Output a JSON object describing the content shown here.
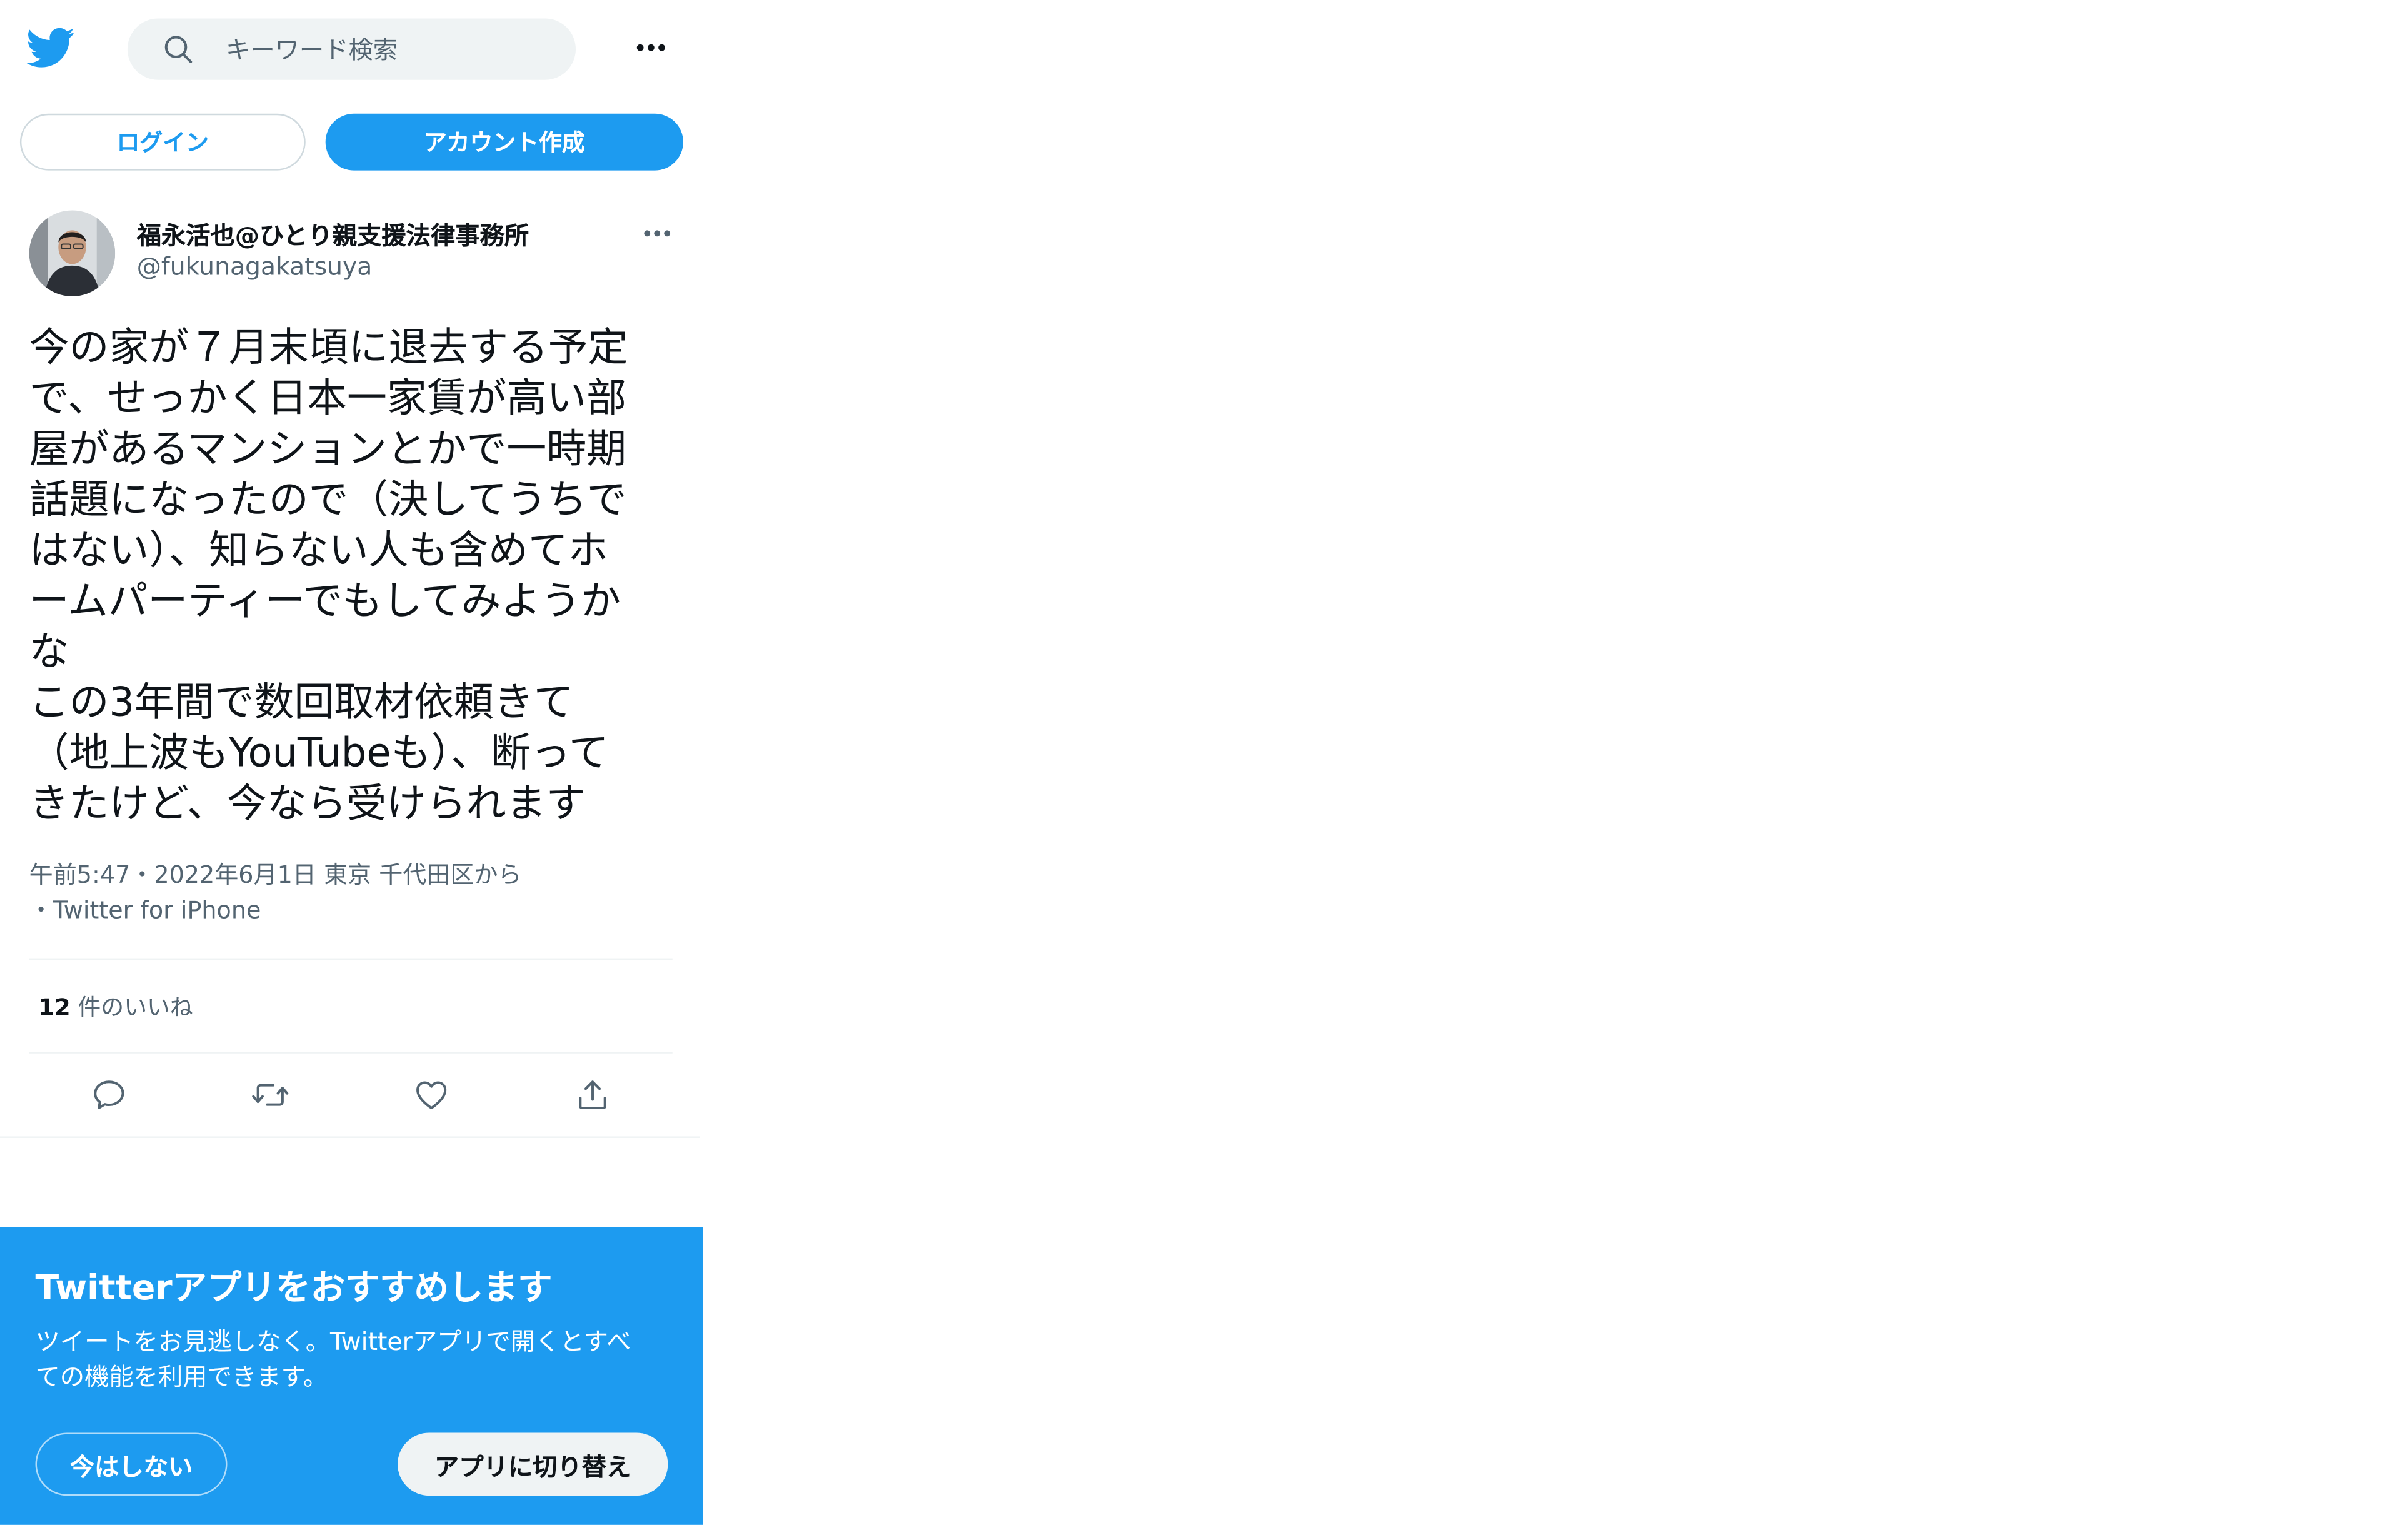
{
  "header": {
    "search_placeholder": "キーワード検索",
    "logo_icon": "twitter-bird-icon",
    "more_icon": "more-horizontal-icon",
    "search_icon": "search-icon"
  },
  "auth": {
    "login_label": "ログイン",
    "signup_label": "アカウント作成"
  },
  "tweet": {
    "author_name": "福永活也@ひとり親支援法律事務所",
    "author_handle": "@fukunagakatsuya",
    "text_lines": [
      "今の家が７月末頃に退去する予定",
      "で、せっかく日本一家賃が高い部",
      "屋があるマンションとかで一時期",
      "話題になったので（決してうちで",
      "はない）、知らない人も含めてホ",
      "ームパーティーでもしてみようか",
      "な",
      "この3年間で数回取材依頼きて",
      "（地上波もYouTubeも）、断って",
      "きたけど、今なら受けられます"
    ],
    "meta_line1": "午前5:47・2022年6月1日 東京 千代田区から",
    "meta_line2": "・Twitter for iPhone",
    "likes_count": "12",
    "likes_label": "件のいいね"
  },
  "actions": {
    "reply_icon": "reply-icon",
    "retweet_icon": "retweet-icon",
    "like_icon": "heart-icon",
    "share_icon": "share-icon"
  },
  "banner": {
    "title": "Twitterアプリをおすすめします",
    "body_lines": [
      "ツイートをお見逃しなく。Twitterアプリで開くとすべ",
      "ての機能を利用できます。"
    ],
    "not_now_label": "今はしない",
    "switch_label": "アプリに切り替え"
  },
  "colors": {
    "brand_blue": "#1d9bf0",
    "text_primary": "#0f1419",
    "text_secondary": "#536471",
    "search_bg": "#eff3f4"
  }
}
